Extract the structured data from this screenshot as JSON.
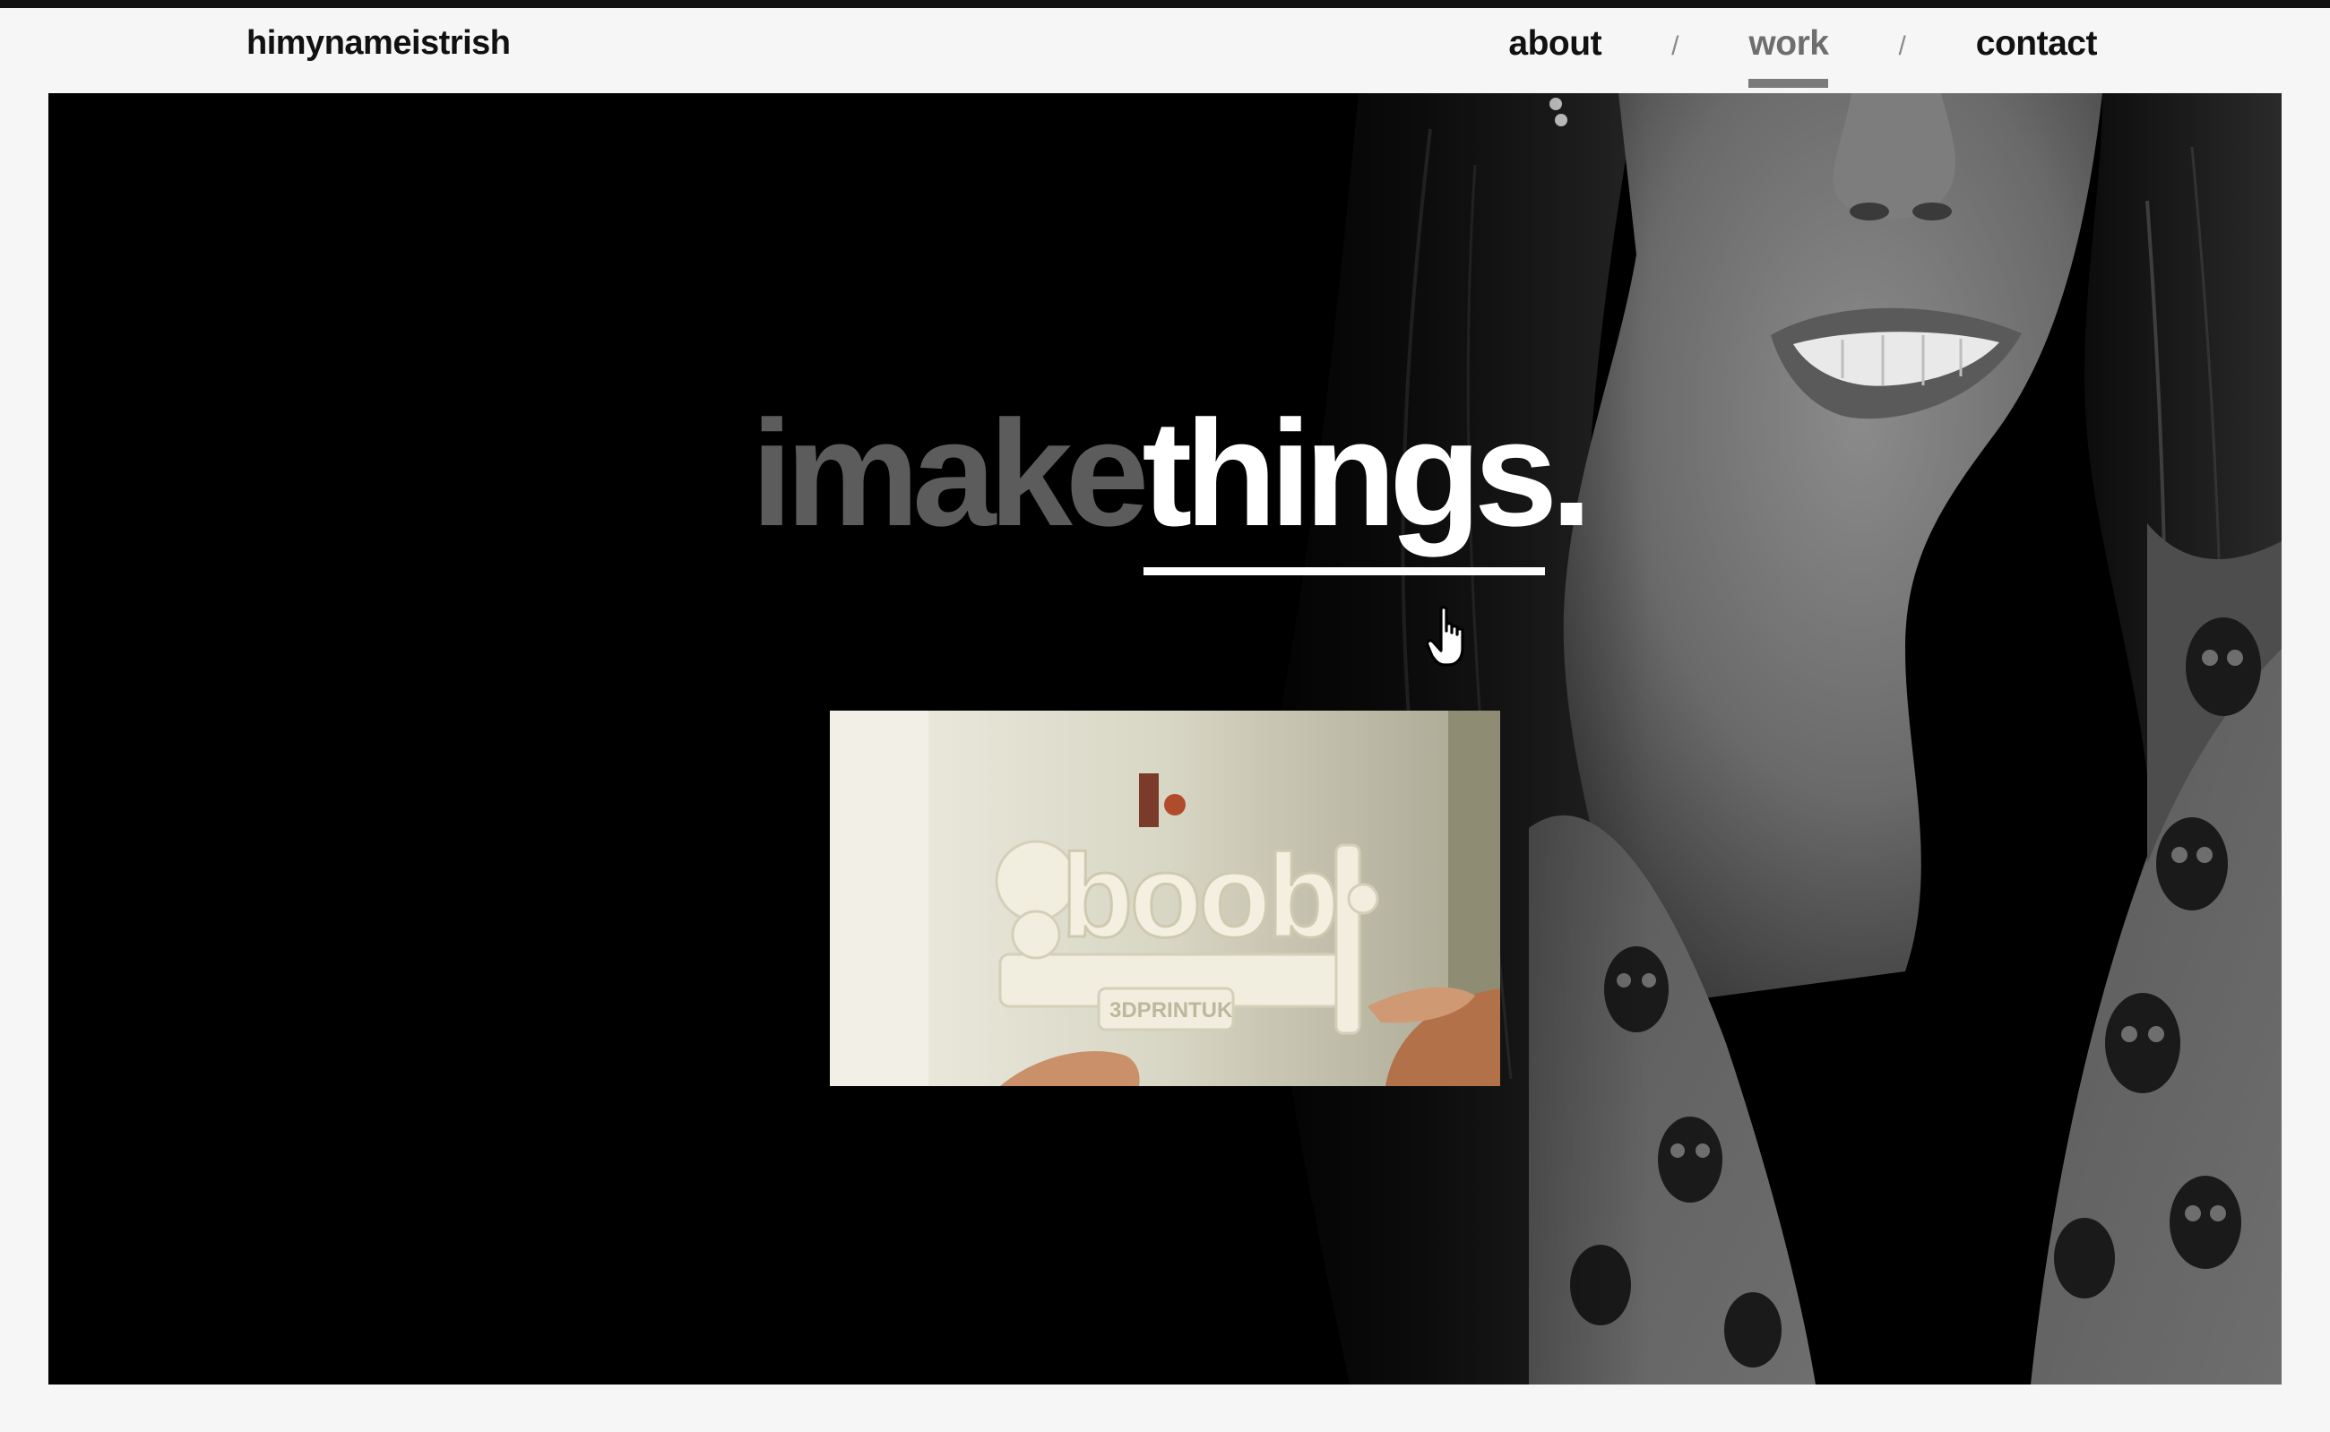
{
  "header": {
    "brand": "himynameistrish",
    "nav": {
      "about": "about",
      "work": "work",
      "contact": "contact",
      "separator": "/",
      "active": "work"
    }
  },
  "hero": {
    "headline_prefix": "imake",
    "headline_link": "things",
    "headline_suffix": ".",
    "thumbnail": {
      "print_text": "boob",
      "plate_text": "3DPRINTUK"
    }
  },
  "colors": {
    "page_bg": "#f6f6f6",
    "hero_bg": "#000000",
    "nav_active": "#6e6e6e",
    "headline_dim": "#5c5c5c",
    "headline_bright": "#ffffff"
  },
  "icons": [
    "hand-pointer-icon"
  ]
}
